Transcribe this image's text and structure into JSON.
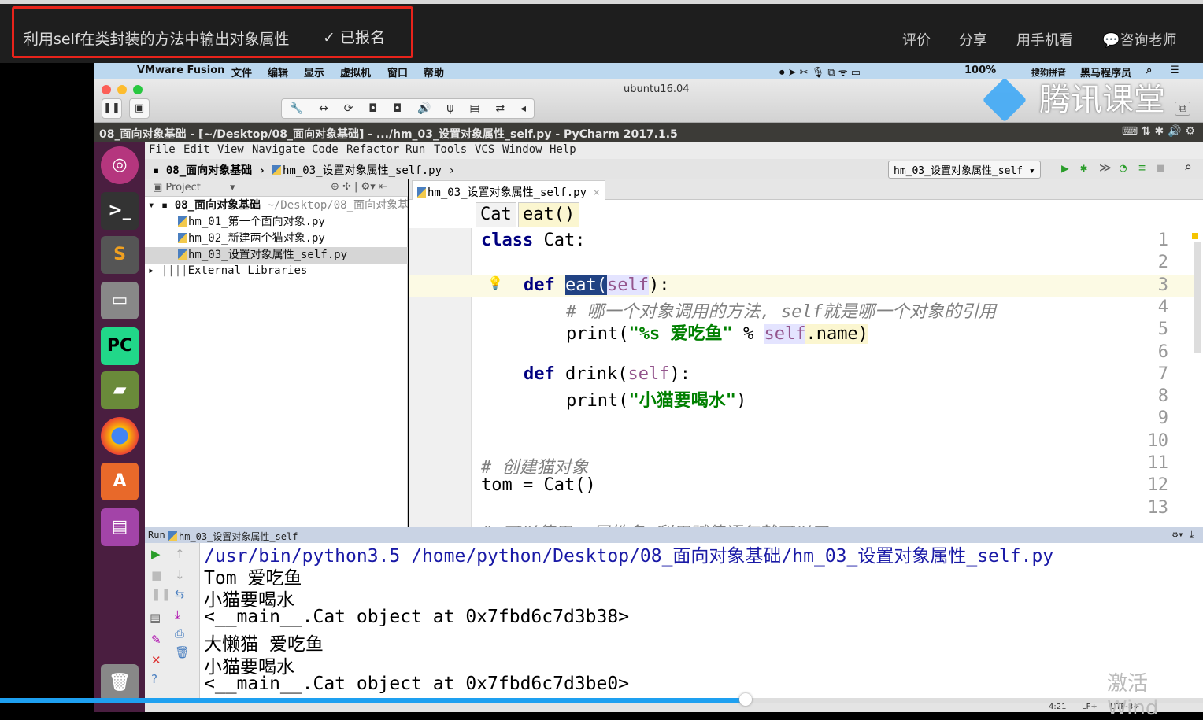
{
  "top": {
    "course_title": "利用self在类封装的方法中输出对象属性",
    "enrolled": "✓ 已报名",
    "links": [
      "评价",
      "分享",
      "用手机看",
      "💬咨询老师"
    ]
  },
  "macbar": {
    "app": "VMware Fusion",
    "menus": [
      "文件",
      "编辑",
      "显示",
      "虚拟机",
      "窗口",
      "帮助"
    ],
    "battery": "100%",
    "input_method": "搜狗拼音",
    "user": "黑马程序员"
  },
  "vm": {
    "name": "ubuntu16.04",
    "watermark": "腾讯课堂"
  },
  "window_title": "08_面向对象基础 - [~/Desktop/08_面向对象基础] - .../hm_03_设置对象属性_self.py - PyCharm 2017.1.5",
  "menu": [
    "File",
    "Edit",
    "View",
    "Navigate",
    "Code",
    "Refactor",
    "Run",
    "Tools",
    "VCS",
    "Window",
    "Help"
  ],
  "nav": {
    "folder": "08_面向对象基础",
    "file": "hm_03_设置对象属性_self.py",
    "run_config": "hm_03_设置对象属性_self"
  },
  "project": {
    "header": "Project",
    "root": "08_面向对象基础",
    "root_path": "~/Desktop/08_面向对象基础",
    "files": [
      "hm_01_第一个面向对象.py",
      "hm_02_新建两个猫对象.py",
      "hm_03_设置对象属性_self.py"
    ],
    "libs": "External Libraries"
  },
  "editor": {
    "tab": "hm_03_设置对象属性_self.py",
    "crumbs": [
      "Cat",
      "eat()"
    ],
    "lines": [
      "1",
      "2",
      "3",
      "4",
      "5",
      "6",
      "7",
      "8",
      "9",
      "10",
      "11",
      "12",
      "13"
    ],
    "code": {
      "l1a": "class",
      "l1b": " Cat:",
      "l3a": "def",
      "l3b": "eat",
      "l3c": "(",
      "l3d": "self",
      "l3e": "):",
      "l4": "# 哪一个对象调用的方法, self就是哪一个对象的引用",
      "l5a": "print(",
      "l5b": "\"%s 爱吃鱼\"",
      "l5c": " % ",
      "l5d": "self",
      ".l5e": "",
      "l5e": ".name)",
      "l7a": "def",
      "l7b": " drink(",
      "l7c": "self",
      "l7d": "):",
      "l8a": "print(",
      "l8b": "\"小猫要喝水\"",
      "l8c": ")",
      "l11": "# 创建猫对象",
      "l12": "tom = Cat()",
      "l14": "# 可以使用 .属性名 利用赋值语句就可以了"
    }
  },
  "run": {
    "label": "Run",
    "config": "hm_03_设置对象属性_self",
    "output": [
      "/usr/bin/python3.5 /home/python/Desktop/08_面向对象基础/hm_03_设置对象属性_self.py",
      "Tom 爱吃鱼",
      "小猫要喝水",
      "<__main__.Cat object at 0x7fbd6c7d3b38>",
      "大懒猫 爱吃鱼",
      "小猫要喝水",
      "<__main__.Cat object at 0x7fbd6c7d3be0>"
    ]
  },
  "status": {
    "position": "4:21",
    "line_sep": "LF÷",
    "encoding": "UTF-8÷"
  },
  "video_progress": 0.62,
  "watermark": "激活 Wind",
  "colors": {
    "accent": "#1ea0f0",
    "highlight_box": "#e8231b",
    "keyword": "#000080",
    "self": "#94558d",
    "string": "#008000"
  }
}
